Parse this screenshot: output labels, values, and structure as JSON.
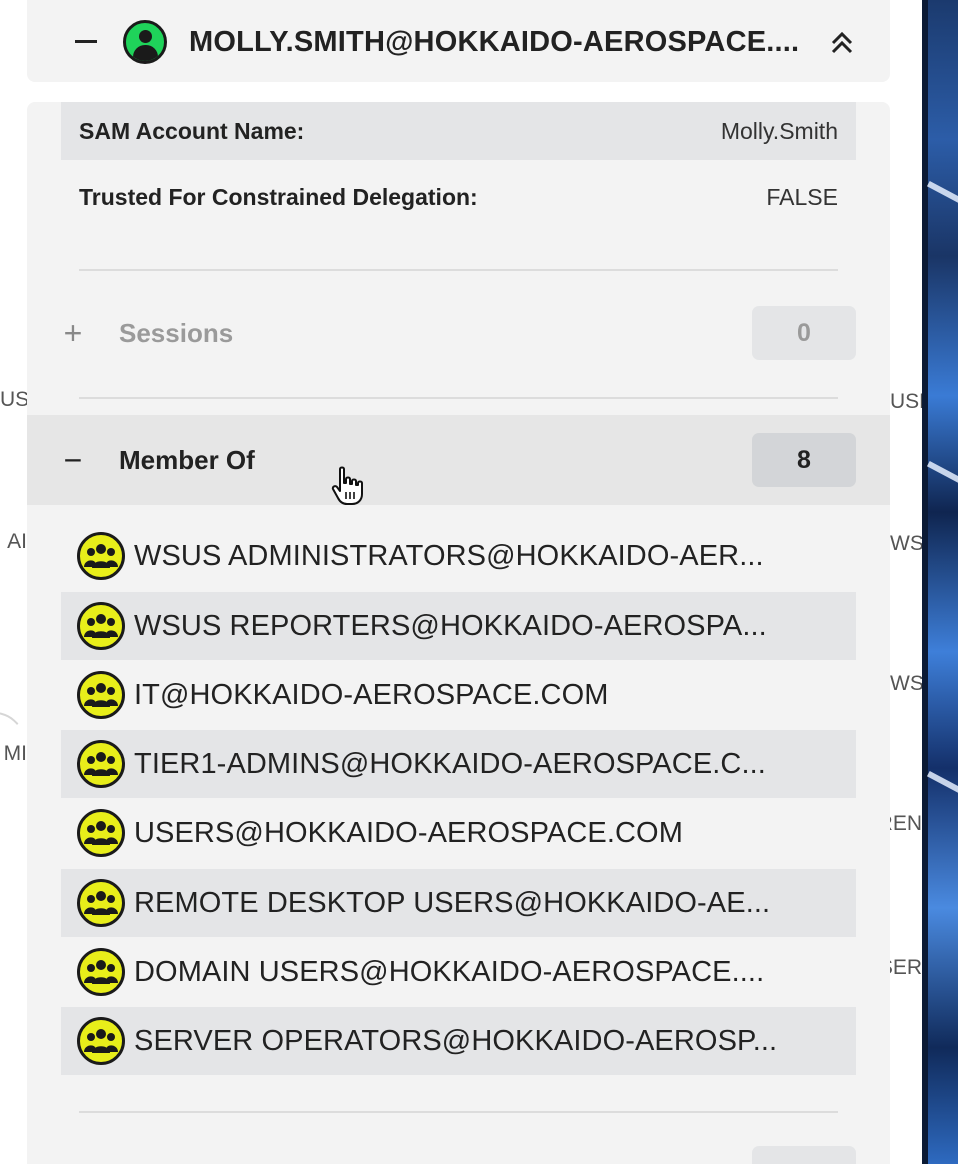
{
  "header": {
    "title": "MOLLY.SMITH@HOKKAIDO-AEROSPACE....",
    "user_status_color": "#1fd35a"
  },
  "properties": [
    {
      "label": "SAM Account Name:",
      "value": "Molly.Smith"
    },
    {
      "label": "Trusted For Constrained Delegation:",
      "value": "FALSE"
    }
  ],
  "sessions": {
    "sign": "+",
    "title": "Sessions",
    "count": "0"
  },
  "member_of": {
    "sign": "−",
    "title": "Member Of",
    "count": "8",
    "groups": [
      {
        "name": "WSUS ADMINISTRATORS@HOKKAIDO-AER..."
      },
      {
        "name": "WSUS REPORTERS@HOKKAIDO-AEROSPA..."
      },
      {
        "name": "IT@HOKKAIDO-AEROSPACE.COM"
      },
      {
        "name": "TIER1-ADMINS@HOKKAIDO-AEROSPACE.C..."
      },
      {
        "name": "USERS@HOKKAIDO-AEROSPACE.COM"
      },
      {
        "name": "REMOTE DESKTOP USERS@HOKKAIDO-AE..."
      },
      {
        "name": "DOMAIN USERS@HOKKAIDO-AEROSPACE...."
      },
      {
        "name": "SERVER OPERATORS@HOKKAIDO-AEROSP..."
      }
    ],
    "group_icon_color": "#e8ee1a"
  },
  "background_labels": {
    "left": [
      "US",
      "AI",
      "MI"
    ],
    "right": [
      "USE",
      "WS",
      "WS",
      "REN",
      "SER"
    ]
  }
}
